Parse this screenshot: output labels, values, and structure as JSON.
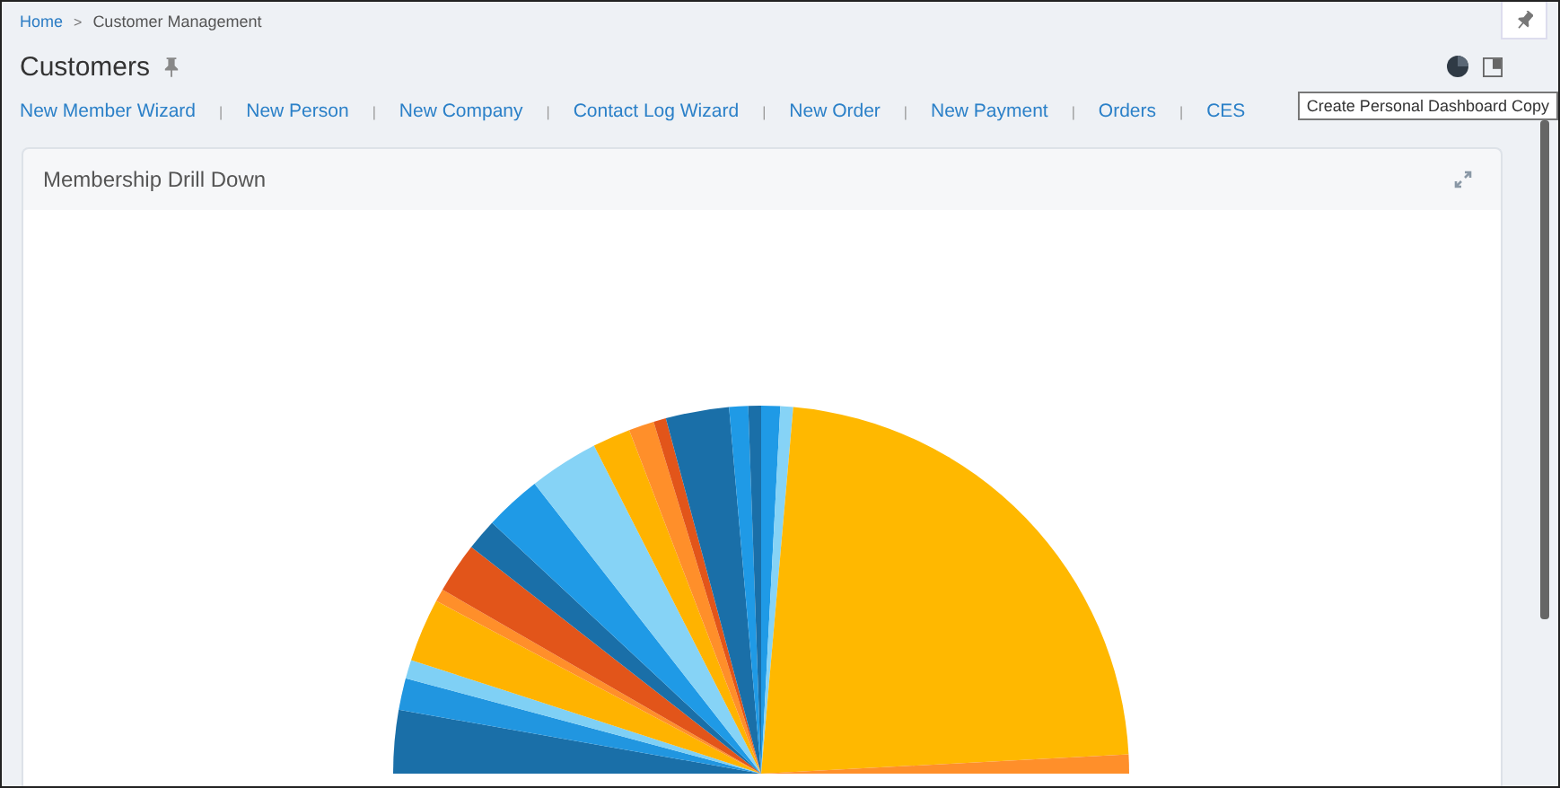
{
  "breadcrumb": [
    {
      "label": "Home",
      "link": true
    },
    {
      "label": "Customer Management",
      "link": false
    }
  ],
  "breadcrumb_separator": ">",
  "page_title": "Customers",
  "action_links": [
    "New Member Wizard",
    "New Person",
    "New Company",
    "Contact Log Wizard",
    "New Order",
    "New Payment",
    "Orders",
    "CES"
  ],
  "link_separator": "|",
  "card": {
    "title": "Membership Drill Down"
  },
  "tooltip": "Create Personal Dashboard Copy"
}
